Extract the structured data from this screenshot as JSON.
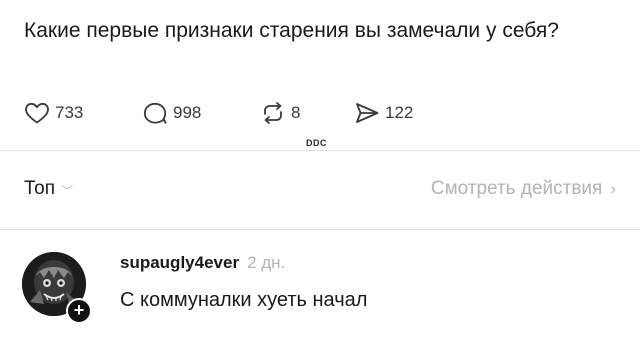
{
  "post": {
    "text": "Какие первые признаки старения вы замечали у себя?"
  },
  "actions": {
    "likes": "733",
    "comments": "998",
    "reposts": "8",
    "shares": "122"
  },
  "watermark": "DDC",
  "sort": {
    "label": "Топ",
    "chevron": "﹀"
  },
  "view_activity": {
    "label": "Смотреть действия",
    "chevron": "›"
  },
  "comment": {
    "username": "supaugly4ever",
    "timestamp": "2 дн.",
    "text": "С коммуналки хуеть начал",
    "follow_symbol": "+"
  },
  "colors": {
    "primary_text": "#1a1a1a",
    "secondary_text": "#b3b3b3",
    "divider": "#e2e2e2",
    "icon": "#3a3a3a"
  },
  "icons": {
    "like": "heart-icon",
    "comment": "comment-bubble-icon",
    "repost": "repost-arrows-icon",
    "share": "share-send-icon"
  }
}
